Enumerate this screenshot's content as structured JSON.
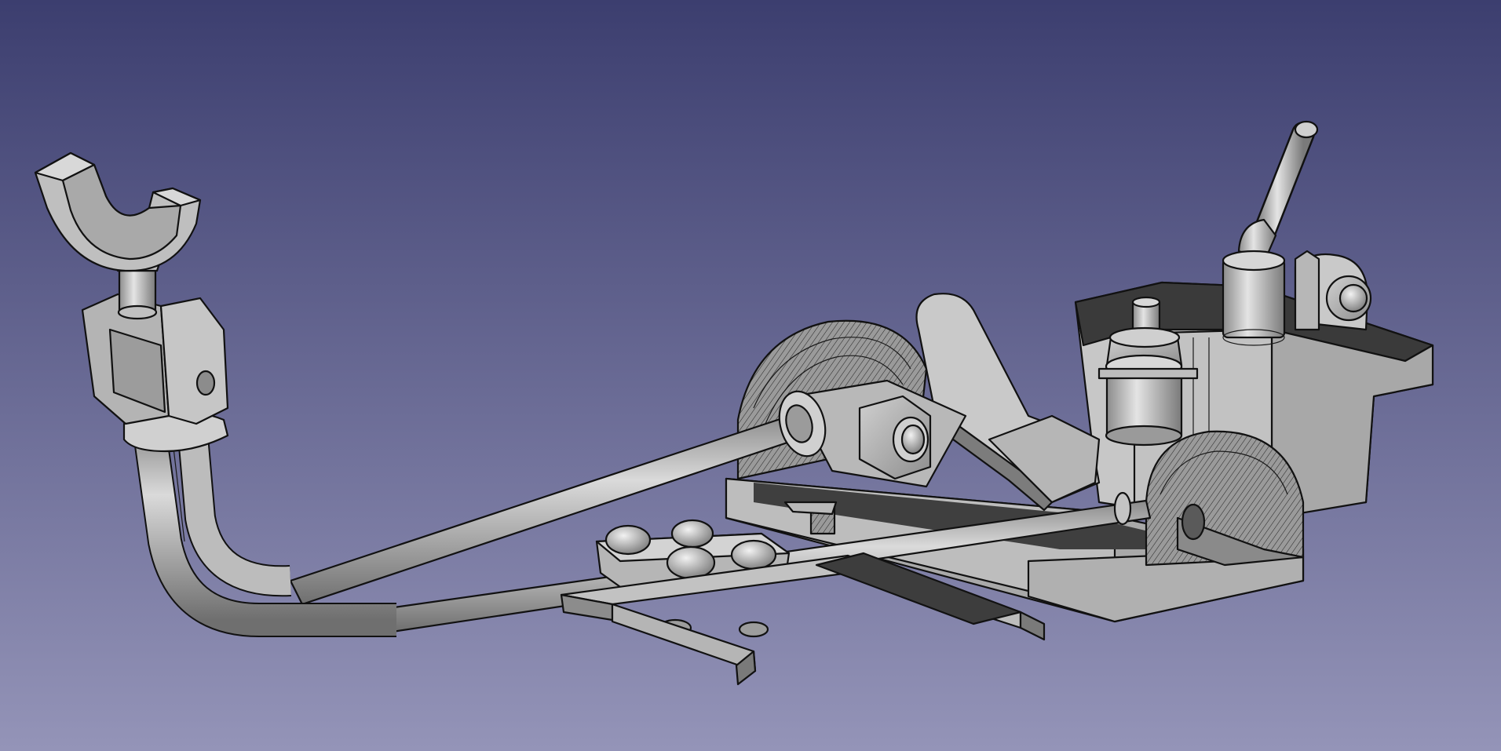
{
  "viewport": {
    "background_top": "#3c3e6f",
    "background_bottom": "#9494b8",
    "model_color": "#b4b4b4",
    "shadow_color": "#4a4a4a",
    "edge_color": "#111111"
  }
}
